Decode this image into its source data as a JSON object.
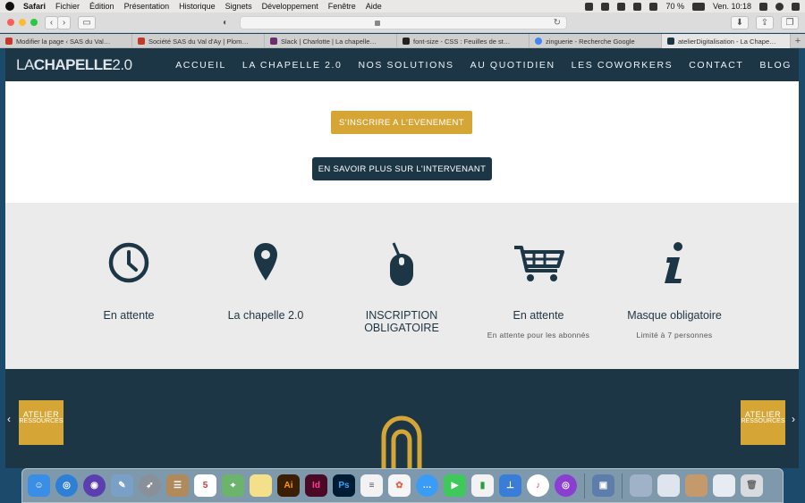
{
  "menubar": {
    "app": "Safari",
    "items": [
      "Fichier",
      "Édition",
      "Présentation",
      "Historique",
      "Signets",
      "Développement",
      "Fenêtre",
      "Aide"
    ],
    "battery": "70 %",
    "clock": "Ven. 10:18"
  },
  "tabs": [
    {
      "label": "Modifier la page ‹ SAS du Val…",
      "color": "#c0392b"
    },
    {
      "label": "Société SAS du Val d'Ay | Plom…",
      "color": "#c0392b"
    },
    {
      "label": "Slack | Charlotte | La chapelle…",
      "color": "#6b2d6b"
    },
    {
      "label": "font-size - CSS : Feuilles de st…",
      "color": "#222222"
    },
    {
      "label": "zinguerie - Recherche Google",
      "color": "#4285f4"
    },
    {
      "label": "atelierDigitalisation - La Chape…",
      "color": "#1c3646",
      "active": true
    }
  ],
  "site": {
    "logo_light": "LA",
    "logo_bold": "CHAPELLE",
    "logo_tail": "2.0",
    "nav": [
      "ACCUEIL",
      "LA CHAPELLE 2.0",
      "NOS SOLUTIONS",
      "AU QUOTIDIEN",
      "LES COWORKERS",
      "CONTACT",
      "BLOG"
    ],
    "btn_register": "S'INSCRIRE A L'EVENEMENT",
    "btn_speaker": "EN SAVOIR PLUS SUR L'INTERVENANT",
    "info": [
      {
        "icon": "clock-icon",
        "title": "En attente",
        "sub": ""
      },
      {
        "icon": "location-pin-icon",
        "title": "La chapelle 2.0",
        "sub": ""
      },
      {
        "icon": "mouse-icon",
        "title": "INSCRIPTION OBLIGATOIRE",
        "sub": ""
      },
      {
        "icon": "cart-icon",
        "title": "En attente",
        "sub": "En attente pour les abonnés"
      },
      {
        "icon": "info-icon",
        "title": "Masque obligatoire",
        "sub": "Limité à 7 personnes"
      }
    ],
    "slide_left": {
      "line1": "ATELIER",
      "line2": "RESSOURCES"
    },
    "slide_right": {
      "line1": "ATELIER",
      "line2": "RESSOURCES"
    }
  },
  "colors": {
    "navy": "#1c3646",
    "gold": "#d5a635",
    "grey": "#ebebeb"
  }
}
